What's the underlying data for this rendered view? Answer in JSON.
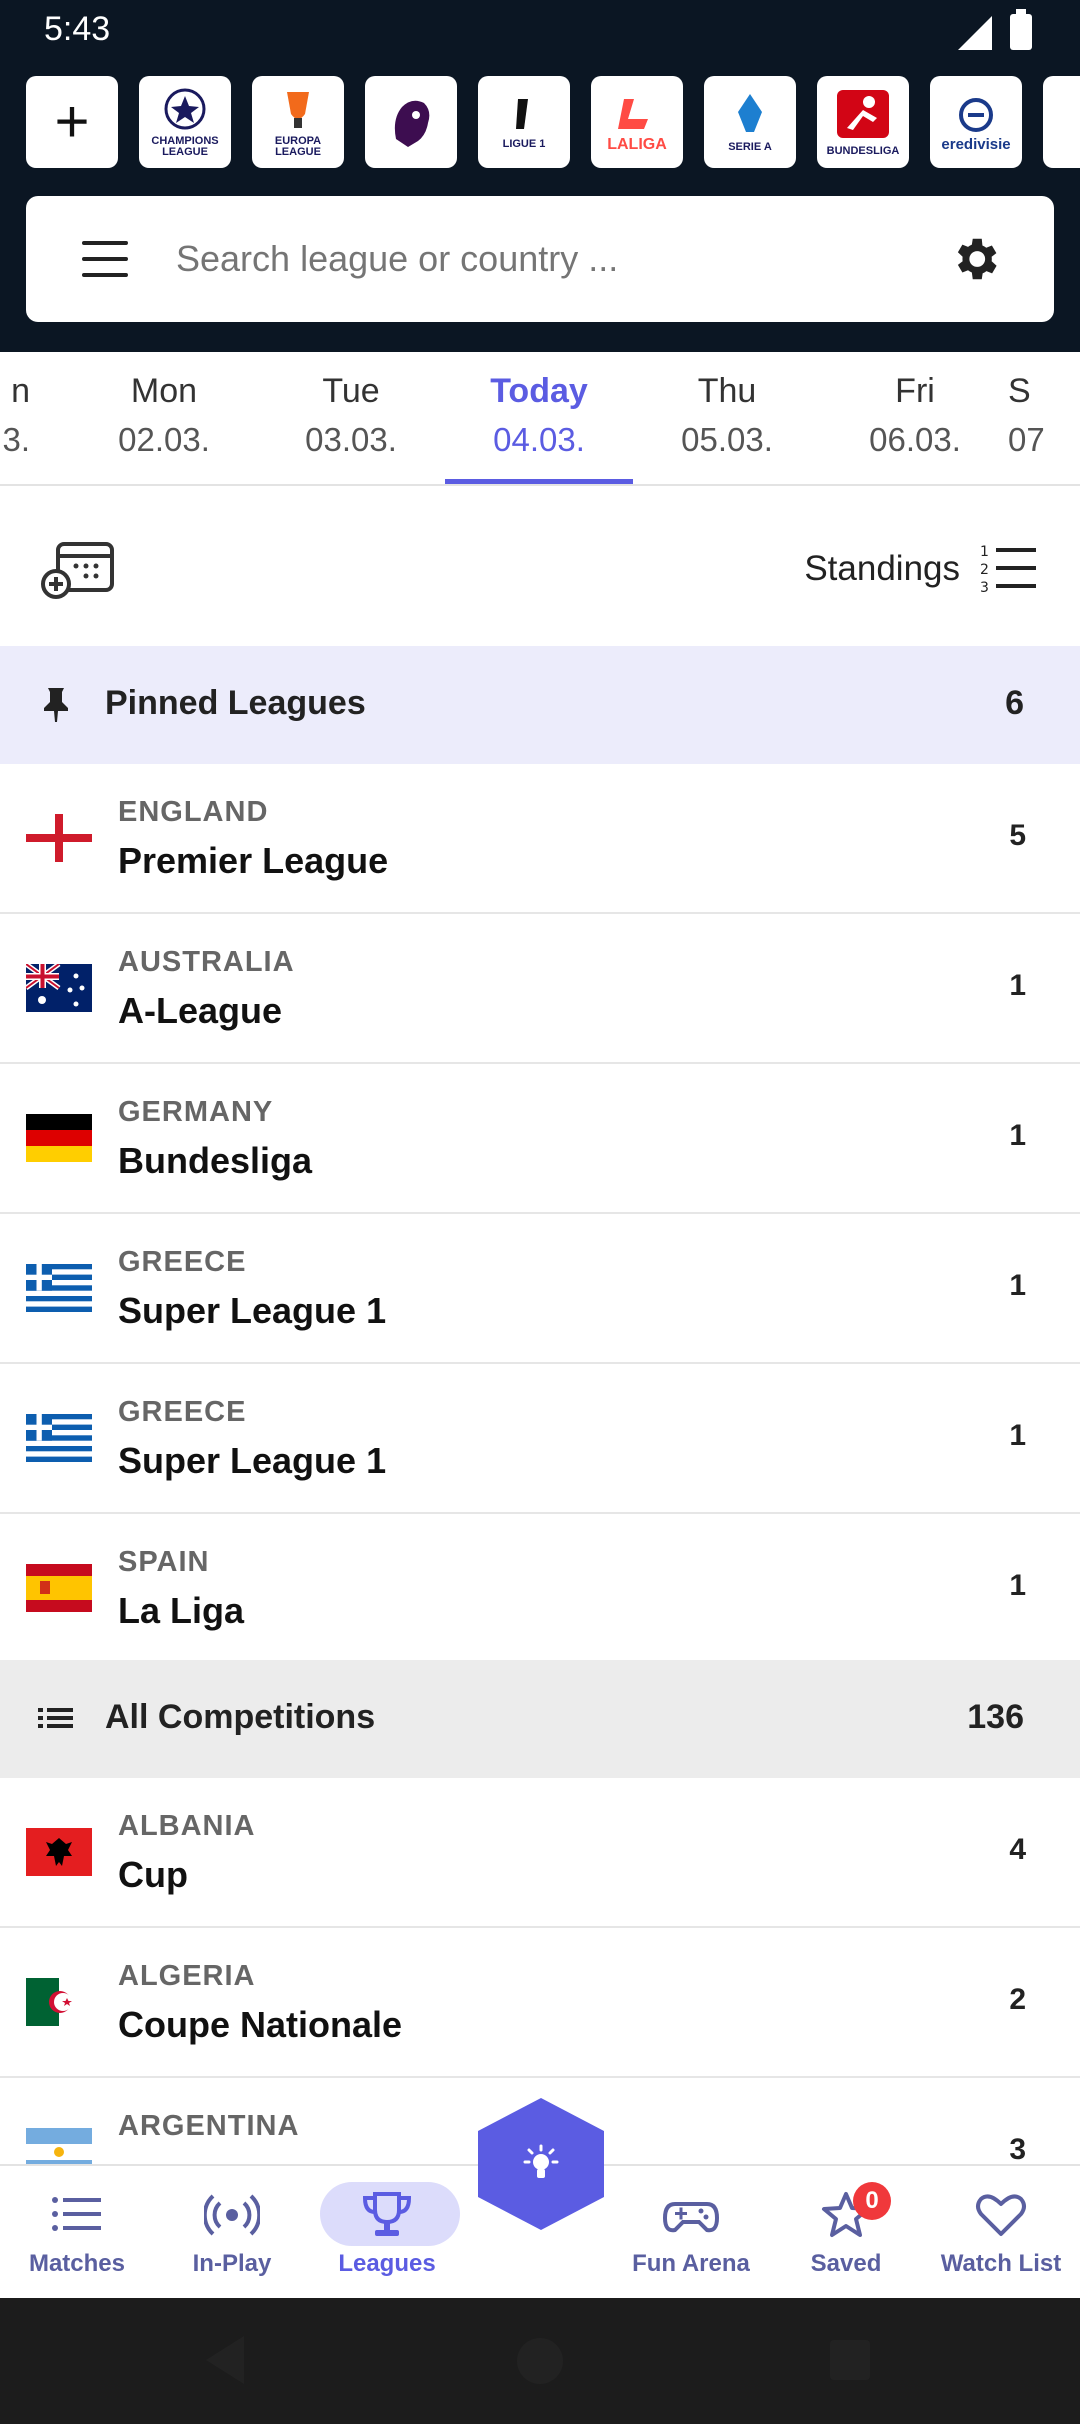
{
  "status": {
    "time": "5:43"
  },
  "logos": [
    {
      "name": "add",
      "label": ""
    },
    {
      "name": "champions-league",
      "label": "CHAMPIONS LEAGUE"
    },
    {
      "name": "europa-league",
      "label": "EUROPA LEAGUE"
    },
    {
      "name": "premier-league",
      "label": ""
    },
    {
      "name": "ligue1",
      "label": "LIGUE 1"
    },
    {
      "name": "laliga",
      "label": "LALIGA"
    },
    {
      "name": "serie-a",
      "label": "SERIE A"
    },
    {
      "name": "bundesliga",
      "label": "BUNDESLIGA"
    },
    {
      "name": "eredivisie",
      "label": "eredivisie"
    }
  ],
  "search": {
    "placeholder": "Search league or country ..."
  },
  "dates": [
    {
      "day": "n",
      "date": "3."
    },
    {
      "day": "Mon",
      "date": "02.03."
    },
    {
      "day": "Tue",
      "date": "03.03."
    },
    {
      "day": "Today",
      "date": "04.03.",
      "active": true
    },
    {
      "day": "Thu",
      "date": "05.03."
    },
    {
      "day": "Fri",
      "date": "06.03."
    },
    {
      "day": "S",
      "date": "07"
    }
  ],
  "tools": {
    "standings_label": "Standings"
  },
  "pinned": {
    "title": "Pinned Leagues",
    "count": "6",
    "rows": [
      {
        "country": "ENGLAND",
        "league": "Premier League",
        "count": "5"
      },
      {
        "country": "AUSTRALIA",
        "league": "A-League",
        "count": "1"
      },
      {
        "country": "GERMANY",
        "league": "Bundesliga",
        "count": "1"
      },
      {
        "country": "GREECE",
        "league": "Super League 1",
        "count": "1"
      },
      {
        "country": "GREECE",
        "league": "Super League 1",
        "count": "1"
      },
      {
        "country": "SPAIN",
        "league": "La Liga",
        "count": "1"
      }
    ]
  },
  "all": {
    "title": "All Competitions",
    "count": "136",
    "rows": [
      {
        "country": "ALBANIA",
        "league": "Cup",
        "count": "4"
      },
      {
        "country": "ALGERIA",
        "league": "Coupe Nationale",
        "count": "2"
      },
      {
        "country": "ARGENTINA",
        "league": "",
        "count": "3"
      }
    ]
  },
  "nav": [
    {
      "label": "Matches"
    },
    {
      "label": "In-Play"
    },
    {
      "label": "Leagues"
    },
    {
      "label": "Fun Arena"
    },
    {
      "label": "Saved",
      "badge": "0"
    },
    {
      "label": "Watch List"
    }
  ],
  "colors": {
    "accent": "#5b5ce2",
    "header_bg": "#0b1623",
    "badge": "#f0383b"
  }
}
